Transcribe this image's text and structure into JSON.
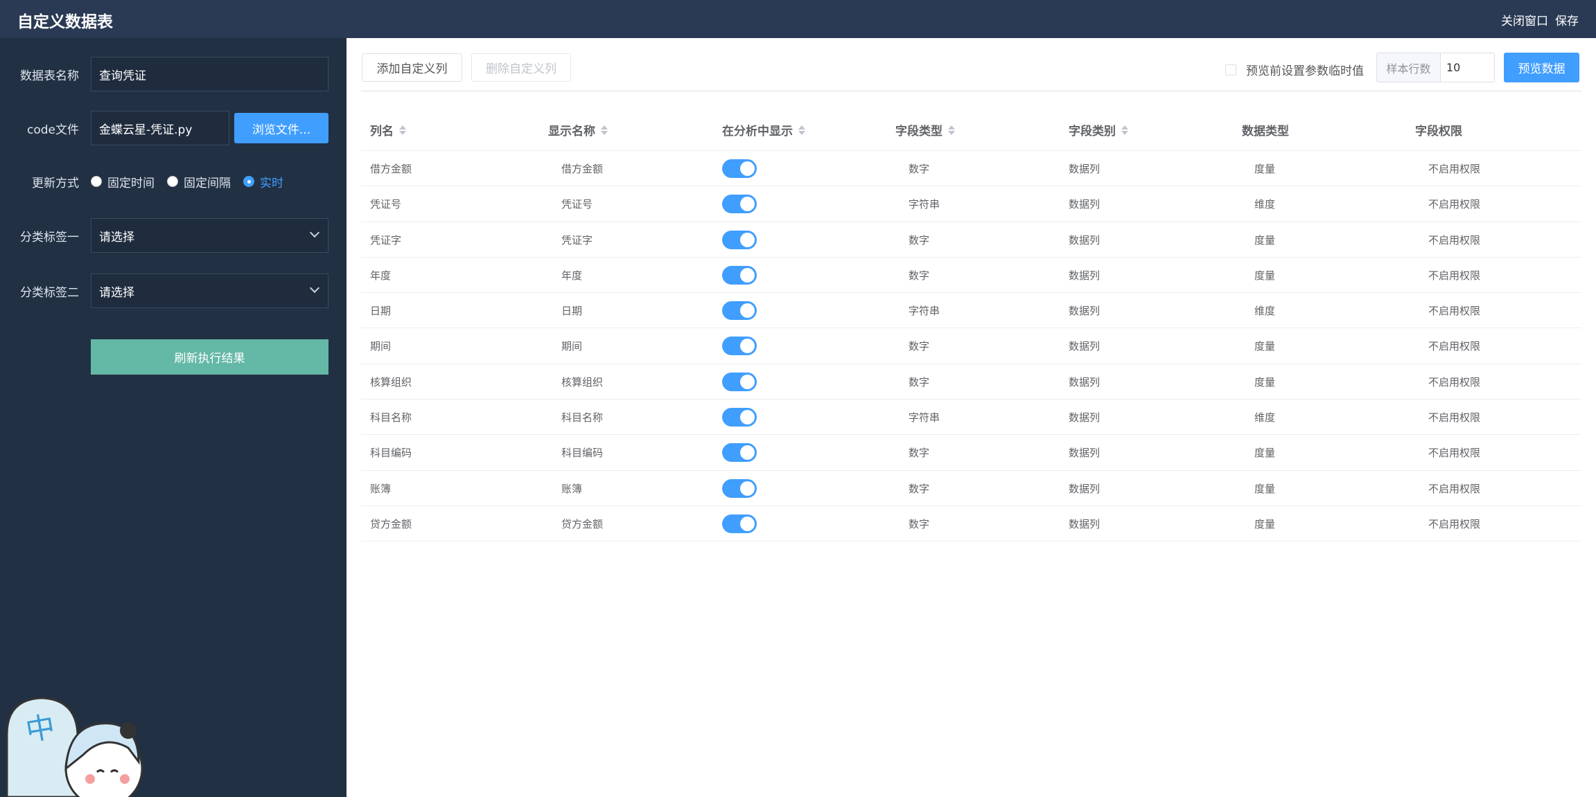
{
  "header": {
    "title": "自定义数据表",
    "close_label": "关闭窗口",
    "save_label": "保存"
  },
  "sidebar": {
    "table_name_label": "数据表名称",
    "table_name_value": "查询凭证",
    "code_file_label": "code文件",
    "code_file_value": "金蝶云星-凭证.py",
    "browse_label": "浏览文件...",
    "update_mode_label": "更新方式",
    "update_options": [
      "固定时间",
      "固定间隔",
      "实时"
    ],
    "update_selected": "实时",
    "tag1_label": "分类标签一",
    "tag1_placeholder": "请选择",
    "tag2_label": "分类标签二",
    "tag2_placeholder": "请选择",
    "refresh_label": "刷新执行结果"
  },
  "toolbar": {
    "add_column": "添加自定义列",
    "delete_column": "删除自定义列",
    "preview_param_label": "预览前设置参数临时值",
    "sample_rows_label": "样本行数",
    "sample_rows_value": "10",
    "preview_label": "预览数据"
  },
  "table": {
    "headers": [
      "列名",
      "显示名称",
      "在分析中显示",
      "字段类型",
      "字段类别",
      "数据类型",
      "字段权限"
    ],
    "rows": [
      {
        "name": "借方金额",
        "display": "借方金额",
        "shown": true,
        "field_type": "数字",
        "category": "数据列",
        "data_type": "度量",
        "permission": "不启用权限"
      },
      {
        "name": "凭证号",
        "display": "凭证号",
        "shown": true,
        "field_type": "字符串",
        "category": "数据列",
        "data_type": "维度",
        "permission": "不启用权限"
      },
      {
        "name": "凭证字",
        "display": "凭证字",
        "shown": true,
        "field_type": "数字",
        "category": "数据列",
        "data_type": "度量",
        "permission": "不启用权限"
      },
      {
        "name": "年度",
        "display": "年度",
        "shown": true,
        "field_type": "数字",
        "category": "数据列",
        "data_type": "度量",
        "permission": "不启用权限"
      },
      {
        "name": "日期",
        "display": "日期",
        "shown": true,
        "field_type": "字符串",
        "category": "数据列",
        "data_type": "维度",
        "permission": "不启用权限"
      },
      {
        "name": "期间",
        "display": "期间",
        "shown": true,
        "field_type": "数字",
        "category": "数据列",
        "data_type": "度量",
        "permission": "不启用权限"
      },
      {
        "name": "核算组织",
        "display": "核算组织",
        "shown": true,
        "field_type": "数字",
        "category": "数据列",
        "data_type": "度量",
        "permission": "不启用权限"
      },
      {
        "name": "科目名称",
        "display": "科目名称",
        "shown": true,
        "field_type": "字符串",
        "category": "数据列",
        "data_type": "维度",
        "permission": "不启用权限"
      },
      {
        "name": "科目编码",
        "display": "科目编码",
        "shown": true,
        "field_type": "数字",
        "category": "数据列",
        "data_type": "度量",
        "permission": "不启用权限"
      },
      {
        "name": "账簿",
        "display": "账簿",
        "shown": true,
        "field_type": "数字",
        "category": "数据列",
        "data_type": "度量",
        "permission": "不启用权限"
      },
      {
        "name": "贷方金额",
        "display": "贷方金额",
        "shown": true,
        "field_type": "数字",
        "category": "数据列",
        "data_type": "度量",
        "permission": "不启用权限"
      }
    ]
  },
  "colors": {
    "header_bg": "#2a3a55",
    "sidebar_bg": "#223044",
    "primary": "#409eff",
    "refresh_btn": "#64b8a6"
  }
}
